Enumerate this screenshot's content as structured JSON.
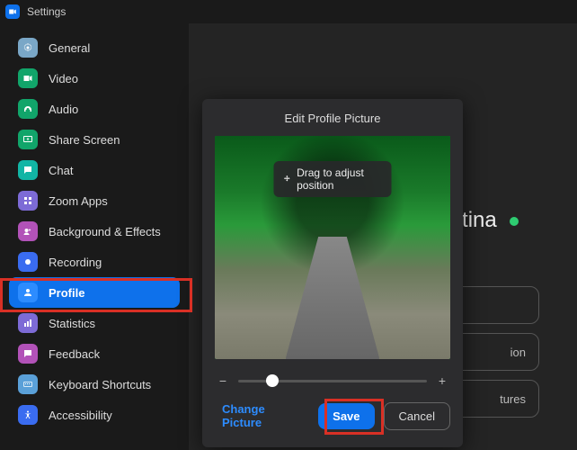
{
  "window": {
    "title": "Settings"
  },
  "sidebar": {
    "items": [
      {
        "label": "General"
      },
      {
        "label": "Video"
      },
      {
        "label": "Audio"
      },
      {
        "label": "Share Screen"
      },
      {
        "label": "Chat"
      },
      {
        "label": "Zoom Apps"
      },
      {
        "label": "Background & Effects"
      },
      {
        "label": "Recording"
      },
      {
        "label": "Profile"
      },
      {
        "label": "Statistics"
      },
      {
        "label": "Feedback"
      },
      {
        "label": "Keyboard Shortcuts"
      },
      {
        "label": "Accessibility"
      }
    ]
  },
  "profile": {
    "display_name_partial": "Argentina",
    "pill1_partial": "ion",
    "pill2_partial": "tures"
  },
  "modal": {
    "title": "Edit Profile Picture",
    "drag_tip": "Drag to adjust position",
    "change_label": "Change Picture",
    "save_label": "Save",
    "cancel_label": "Cancel"
  }
}
